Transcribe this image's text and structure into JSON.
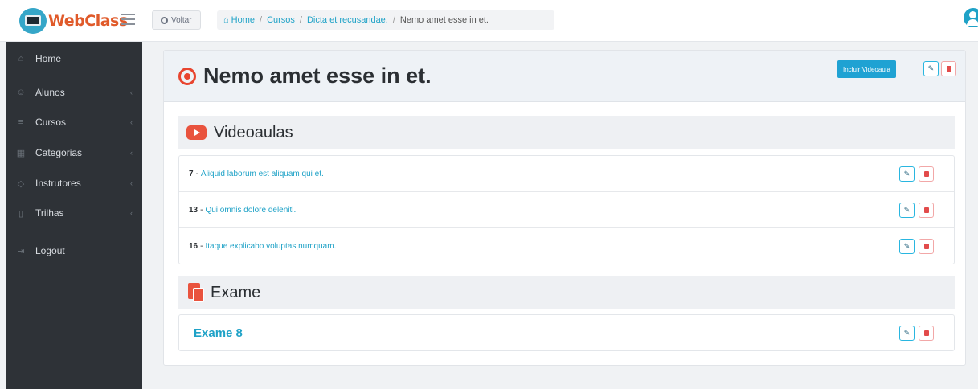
{
  "brand": {
    "name": "WebClass"
  },
  "topbar": {
    "back_label": "Voltar",
    "breadcrumb": {
      "home": "Home",
      "items": [
        "Cursos",
        "Dicta et recusandae."
      ],
      "current": "Nemo amet esse in et."
    }
  },
  "sidebar": {
    "items": [
      {
        "label": "Home",
        "icon": "home-icon",
        "has_submenu": false
      },
      {
        "label": "Alunos",
        "icon": "users-icon",
        "has_submenu": true
      },
      {
        "label": "Cursos",
        "icon": "list-icon",
        "has_submenu": true
      },
      {
        "label": "Categorias",
        "icon": "grid-icon",
        "has_submenu": true
      },
      {
        "label": "Instrutores",
        "icon": "graduation-cap-icon",
        "has_submenu": true
      },
      {
        "label": "Trilhas",
        "icon": "columns-icon",
        "has_submenu": true
      },
      {
        "label": "Logout",
        "icon": "logout-icon",
        "has_submenu": false
      }
    ]
  },
  "main": {
    "title": "Nemo amet esse in et.",
    "add_video_label": "Incluir Videoaula",
    "videos_section": {
      "title": "Videoaulas",
      "items": [
        {
          "number": "7",
          "title": "Aliquid laborum est aliquam qui et."
        },
        {
          "number": "13",
          "title": "Qui omnis dolore deleniti."
        },
        {
          "number": "16",
          "title": "Itaque explicabo voluptas numquam."
        }
      ]
    },
    "exam_section": {
      "title": "Exame",
      "exam_label": "Exame 8"
    }
  },
  "colors": {
    "accent": "#1fa2c7",
    "danger": "#e9533e",
    "sidebar_bg": "#2e3237",
    "brand_orange": "#e05a2a"
  }
}
